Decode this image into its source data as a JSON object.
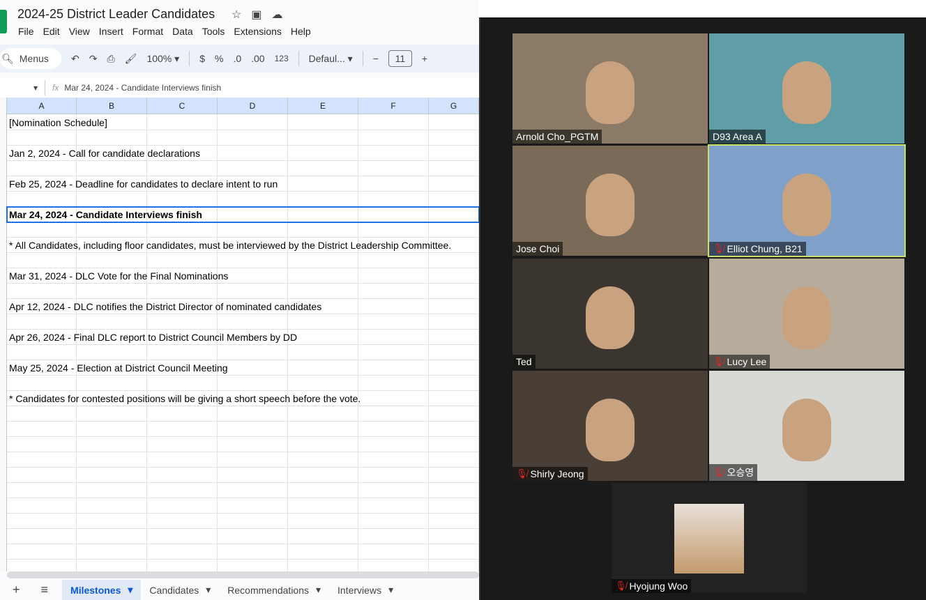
{
  "doc": {
    "title": "2024-25 District Leader Candidates"
  },
  "menu": [
    "File",
    "Edit",
    "View",
    "Insert",
    "Format",
    "Data",
    "Tools",
    "Extensions",
    "Help"
  ],
  "toolbar": {
    "search": "Menus",
    "zoom": "100%",
    "currency": "$",
    "percent": "%",
    "dec_dec": ".0",
    "inc_dec": ".00",
    "format123": "123",
    "font": "Defaul...",
    "font_size": "11",
    "minus": "−",
    "plus": "+"
  },
  "formula": {
    "fx": "fx",
    "value": "Mar 24, 2024 - Candidate Interviews finish"
  },
  "columns": [
    "A",
    "B",
    "C",
    "D",
    "E",
    "F",
    "G"
  ],
  "rows": [
    "[Nomination Schedule]",
    "",
    "Jan 2, 2024 - Call for candidate declarations",
    "",
    "Feb 25, 2024 - Deadline for candidates to declare intent to run",
    "",
    "Mar 24, 2024 - Candidate Interviews finish",
    "",
    "* All Candidates, including floor candidates, must be interviewed by the District Leadership Committee.",
    "",
    "Mar 31, 2024 - DLC Vote for the Final Nominations",
    "",
    "Apr 12, 2024 - DLC notifies the District Director of nominated candidates",
    "",
    "Apr 26, 2024 - Final DLC report to District Council Members by DD",
    "",
    "May 25, 2024 - Election at District Council Meeting",
    "",
    "* Candidates for contested positions will be giving a short speech before the vote."
  ],
  "tabs": [
    "Milestones",
    "Candidates",
    "Recommendations",
    "Interviews"
  ],
  "participants": [
    {
      "name": "Arnold Cho_PGTM",
      "muted": false,
      "bg": "#8a7a66"
    },
    {
      "name": "D93 Area A",
      "muted": false,
      "bg": "#5f9ea6"
    },
    {
      "name": "Jose Choi",
      "muted": false,
      "bg": "#7a6a58"
    },
    {
      "name": "Elliot Chung, B21",
      "muted": true,
      "bg": "#7fa0c8"
    },
    {
      "name": "Ted",
      "muted": false,
      "bg": "#3a352f"
    },
    {
      "name": "Lucy Lee",
      "muted": true,
      "bg": "#b7ab9b"
    },
    {
      "name": "Shirly Jeong",
      "muted": true,
      "bg": "#4a3f36"
    },
    {
      "name": "오승영",
      "muted": true,
      "bg": "#d8d8d4"
    },
    {
      "name": "Hyojung Woo",
      "muted": true,
      "bg": "#222222"
    }
  ]
}
